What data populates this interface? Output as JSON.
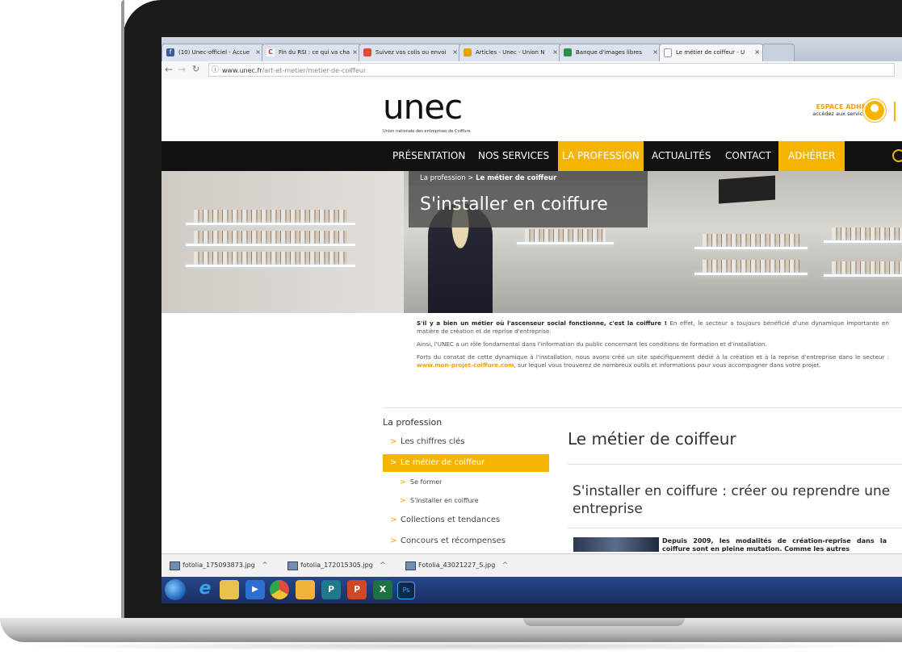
{
  "browser": {
    "tabs": [
      {
        "label": "(10) Unec-officiel - Accue",
        "icon": "facebook-icon",
        "color": "#3b5998"
      },
      {
        "label": "Fin du RSI : ce qui va cha",
        "icon": "c-site-icon",
        "color": "#c0392b"
      },
      {
        "label": "Suivez vos colis ou envoi",
        "icon": "parcel-icon",
        "color": "#e04a2f"
      },
      {
        "label": "Articles - Unec - Union N",
        "icon": "grid-icon",
        "color": "#e6a400"
      },
      {
        "label": "Banque d'images libres",
        "icon": "image-bank-icon",
        "color": "#2a8f4c"
      },
      {
        "label": "Le métier de coiffeur - U",
        "icon": "page-icon",
        "color": "#888888"
      }
    ],
    "close_glyph": "×",
    "url_domain": "www.unec.fr",
    "url_path": "/art-et-metier/metier-de-coiffeur"
  },
  "site": {
    "logo": "unec",
    "logo_tagline": "Union nationale des entreprises de Coiffure",
    "member_title": "ESPACE ADHÉRENT",
    "member_sub": "accédez aux services UNEC",
    "menu": [
      {
        "label": "PRÉSENTATION",
        "active": false
      },
      {
        "label": "NOS SERVICES",
        "active": false
      },
      {
        "label": "LA PROFESSION",
        "active": true
      },
      {
        "label": "ACTUALITÉS",
        "active": false
      },
      {
        "label": "CONTACT",
        "active": false
      },
      {
        "label": "ADHÉRER",
        "active": true
      }
    ],
    "accent_color": "#f5b400"
  },
  "hero": {
    "breadcrumb_parent": "La profession",
    "breadcrumb_sep": " > ",
    "breadcrumb_current": "Le métier de coiffeur",
    "title": "S'installer en coiffure"
  },
  "intro": {
    "p1_bold": "S'il y a bien un métier où l'ascenseur social fonctionne, c'est la coiffure !",
    "p1_rest": " En effet, le secteur a toujours bénéficié d'une dynamique importante en matière de création et de reprise d'entreprise.",
    "p2": "Ainsi, l'UNEC a un rôle fondamental dans l'information du public concernant les conditions de formation et d'installation.",
    "p3_a": "Forts du constat de cette dynamique à l'installation, nous avons créé un site spécifiquement dédié à la création et à la reprise d'entreprise dans le secteur : ",
    "p3_link": "www.mon-projet-coiffure.com",
    "p3_b": ", sur lequel vous trouverez de nombreux outils et informations pour vous accompagner dans votre projet."
  },
  "sidebar": {
    "title": "La profession",
    "items": [
      {
        "label": "Les chiffres clés",
        "sub": false,
        "active": false
      },
      {
        "label": "Le métier de coiffeur",
        "sub": false,
        "active": true
      },
      {
        "label": "Se former",
        "sub": true,
        "active": false
      },
      {
        "label": "S'installer en coiffure",
        "sub": true,
        "active": false
      },
      {
        "label": "Collections et tendances",
        "sub": false,
        "active": false
      },
      {
        "label": "Concours et récompenses",
        "sub": false,
        "active": false
      }
    ]
  },
  "main": {
    "heading": "Le métier de coiffeur",
    "subheading": "S'installer en coiffure : créer ou reprendre une entreprise",
    "article_text": "Depuis 2009, les modalités de création-reprise dans la coiffure sont en pleine mutation. Comme les autres"
  },
  "downloads": [
    {
      "name": "fotolia_175093873.jpg"
    },
    {
      "name": "fotolia_172015305.jpg"
    },
    {
      "name": "Fotolia_43021227_S.jpg"
    }
  ],
  "taskbar": {
    "apps": [
      {
        "name": "internet-explorer-icon",
        "color": "#3aa0e8",
        "glyph": "e"
      },
      {
        "name": "file-explorer-icon",
        "color": "#e8c24a",
        "glyph": ""
      },
      {
        "name": "media-player-icon",
        "color": "#2f6fd0",
        "glyph": "▶"
      },
      {
        "name": "chrome-icon",
        "color": "#e24a3a",
        "glyph": ""
      },
      {
        "name": "folder-icon",
        "color": "#f0b43a",
        "glyph": ""
      },
      {
        "name": "publisher-icon",
        "color": "#1e7a8a",
        "glyph": "P"
      },
      {
        "name": "powerpoint-icon",
        "color": "#d24726",
        "glyph": "P"
      },
      {
        "name": "excel-icon",
        "color": "#1e7145",
        "glyph": "X"
      },
      {
        "name": "photoshop-icon",
        "color": "#0b2b48",
        "glyph": "Ps"
      }
    ]
  }
}
